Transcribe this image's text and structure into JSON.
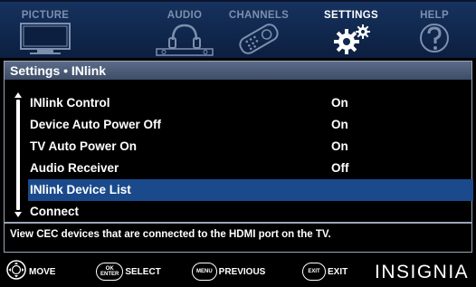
{
  "tabs": [
    {
      "label": "PICTURE",
      "icon": "tv-icon",
      "active": false
    },
    {
      "label": "AUDIO",
      "icon": "headphones-icon",
      "active": false
    },
    {
      "label": "CHANNELS",
      "icon": "remote-icon",
      "active": false
    },
    {
      "label": "SETTINGS",
      "icon": "gears-icon",
      "active": true
    },
    {
      "label": "HELP",
      "icon": "question-icon",
      "active": false
    }
  ],
  "panel": {
    "title": "Settings • INlink",
    "items": [
      {
        "label": "INlink Control",
        "value": "On"
      },
      {
        "label": "Device Auto Power Off",
        "value": "On"
      },
      {
        "label": "TV Auto Power On",
        "value": "On"
      },
      {
        "label": "Audio Receiver",
        "value": "Off"
      },
      {
        "label": "INlink Device List",
        "value": "",
        "selected": true
      },
      {
        "label": "Connect",
        "value": ""
      }
    ],
    "description": "View CEC devices that are connected to the HDMI port on the TV."
  },
  "hints": [
    {
      "button": "",
      "label": "MOVE",
      "icon": "dpad-icon"
    },
    {
      "button": "OK ENTER",
      "label": "SELECT"
    },
    {
      "button": "MENU",
      "label": "PREVIOUS"
    },
    {
      "button": "EXIT",
      "label": "EXIT"
    }
  ],
  "brand": "INSIGNIA",
  "colors": {
    "tab_bar": "#16325e",
    "selected_row": "#1a4a8c",
    "header": "#5b6c88",
    "inactive_tab_text": "#7c8fad"
  }
}
